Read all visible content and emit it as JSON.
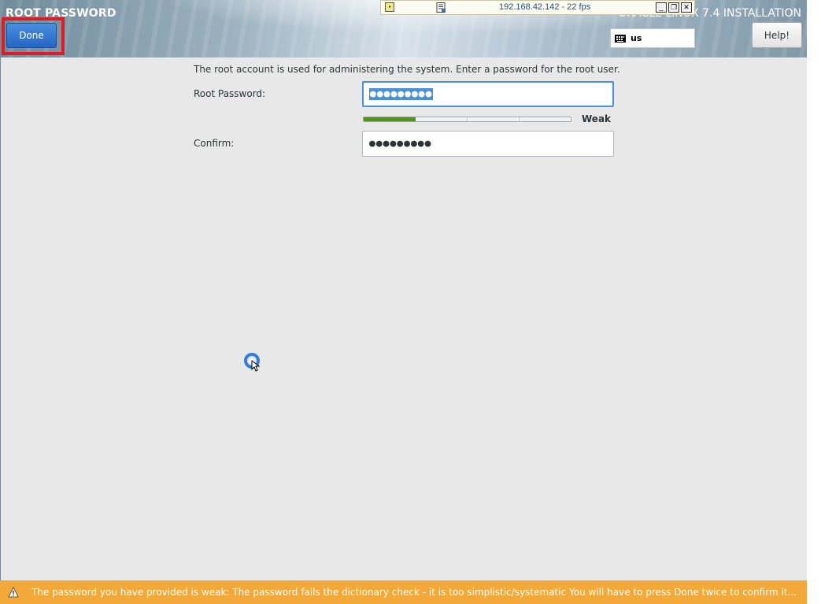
{
  "header": {
    "screen_title": "ROOT PASSWORD",
    "product_title": "ORACLE LINUX 7.4 INSTALLATION",
    "done_label": "Done",
    "help_label": "Help!",
    "keyboard_layout": "us"
  },
  "vnc": {
    "title": "192.168.42.142 - 22 fps",
    "minimize_glyph": "_",
    "restore_glyph": "❐",
    "close_glyph": "✕",
    "pin_glyph": "▪"
  },
  "form": {
    "intro": "The root account is used for administering the system.  Enter a password for the root user.",
    "root_password_label": "Root Password:",
    "root_password_value": "●●●●●●●●●",
    "confirm_label": "Confirm:",
    "confirm_value": "●●●●●●●●●",
    "strength_label": "Weak",
    "strength_level": 0.25
  },
  "warning": {
    "text": "The password you have provided is weak: The password fails the dictionary check - it is too simplistic/systematic You will have to press Done twice to confirm it..."
  },
  "colors": {
    "accent": "#4a90d9",
    "done_button": "#2f74d0",
    "warning_bar": "#f3a83a",
    "strength_fill": "#4e9a06",
    "highlight_box": "#e01b24"
  },
  "icons": {
    "keyboard": "keyboard-icon",
    "warning": "warning-icon",
    "cursor": "busy-cursor-icon"
  }
}
